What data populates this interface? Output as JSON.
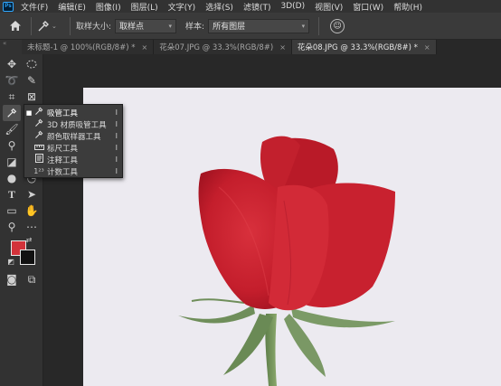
{
  "app": {
    "logo": "Ps"
  },
  "menu": [
    "文件(F)",
    "编辑(E)",
    "图像(I)",
    "图层(L)",
    "文字(Y)",
    "选择(S)",
    "滤镜(T)",
    "3D(D)",
    "视图(V)",
    "窗口(W)",
    "帮助(H)"
  ],
  "options": {
    "sample_size_label": "取样大小:",
    "sample_size_value": "取样点",
    "sample_label": "样本:",
    "sample_value": "所有图层"
  },
  "tabs": [
    {
      "label": "未标题-1 @ 100%(RGB/8#) *",
      "close": "×"
    },
    {
      "label": "花朵07.JPG @ 33.3%(RGB/8#)",
      "close": "×"
    },
    {
      "label": "花朵08.JPG @ 33.3%(RGB/8#) *",
      "close": "×"
    }
  ],
  "toolbar": {
    "collapse": "«"
  },
  "flyout": [
    {
      "label": "吸管工具",
      "key": "I",
      "icon": "eyedropper-icon"
    },
    {
      "label": "3D 材质吸管工具",
      "key": "I",
      "icon": "3d-eyedropper-icon"
    },
    {
      "label": "颜色取样器工具",
      "key": "I",
      "icon": "color-sampler-icon"
    },
    {
      "label": "标尺工具",
      "key": "I",
      "icon": "ruler-icon"
    },
    {
      "label": "注释工具",
      "key": "I",
      "icon": "note-icon"
    },
    {
      "label": "计数工具",
      "key": "I",
      "icon": "count-icon"
    }
  ],
  "colors": {
    "foreground": "#d2323a",
    "background": "#111111",
    "accent": "#31a8ff"
  }
}
